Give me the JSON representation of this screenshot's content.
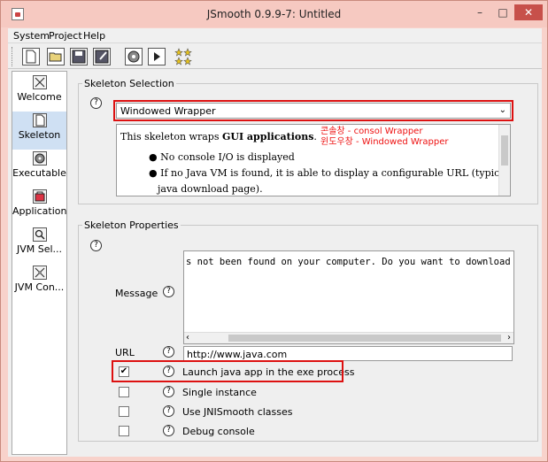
{
  "window": {
    "title": "JSmooth 0.9.9-7: Untitled",
    "minimize": "–",
    "maximize": "□",
    "close": "✕"
  },
  "menu": [
    "System",
    "Project",
    "Help"
  ],
  "toolbar_icons": [
    "new-icon",
    "open-icon",
    "save-icon",
    "save-as-icon",
    "compile-icon",
    "run-icon",
    "about-icon"
  ],
  "sidebar": {
    "items": [
      {
        "label": "Welcome",
        "icon": "welcome-icon"
      },
      {
        "label": "Skeleton",
        "icon": "skeleton-icon",
        "selected": true
      },
      {
        "label": "Executable",
        "icon": "executable-icon"
      },
      {
        "label": "Application",
        "icon": "application-icon"
      },
      {
        "label": "JVM Sel...",
        "icon": "jvm-selection-icon"
      },
      {
        "label": "JVM Con...",
        "icon": "jvm-configuration-icon"
      }
    ]
  },
  "skeleton_selection": {
    "title": "Skeleton Selection",
    "selected": "Windowed Wrapper",
    "description": {
      "line1_prefix": "This skeleton wraps ",
      "line1_bold": "GUI applications",
      "line1_suffix": ".",
      "bullets": [
        "No console I/O is displayed",
        "If no Java VM is found, it is able to display a configurable URL (typically to a"
      ],
      "continuation": "java download page)."
    },
    "annotation_1": "콘솔창 - consol Wrapper",
    "annotation_2": "윈도우창 - Windowed Wrapper"
  },
  "skeleton_properties": {
    "title": "Skeleton Properties",
    "message_label": "Message",
    "message_value": "s not been found on your computer. Do you want to download it?",
    "url_label": "URL",
    "url_value": "http://www.java.com",
    "checkboxes": [
      {
        "label": "Launch java app in the exe process",
        "checked": true,
        "mark": "✔"
      },
      {
        "label": "Single instance",
        "checked": false,
        "mark": ""
      },
      {
        "label": "Use JNISmooth classes",
        "checked": false,
        "mark": ""
      },
      {
        "label": "Debug console",
        "checked": false,
        "mark": ""
      }
    ]
  },
  "colors": {
    "highlight_red": "#dd1111",
    "selection_blue": "#cfe0f3"
  }
}
